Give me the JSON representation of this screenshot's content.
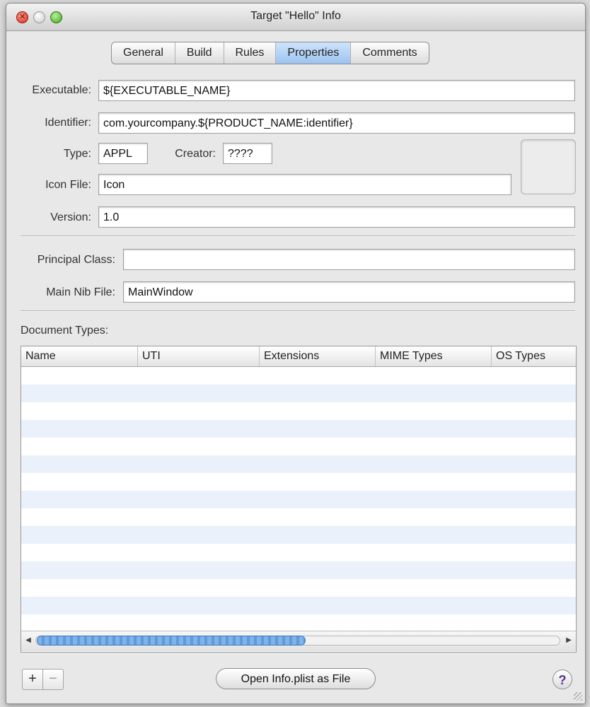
{
  "window": {
    "title": "Target \"Hello\" Info"
  },
  "tabs": [
    {
      "label": "General"
    },
    {
      "label": "Build"
    },
    {
      "label": "Rules"
    },
    {
      "label": "Properties",
      "selected": true
    },
    {
      "label": "Comments"
    }
  ],
  "properties": {
    "executable": {
      "label": "Executable:",
      "value": "${EXECUTABLE_NAME}"
    },
    "identifier": {
      "label": "Identifier:",
      "value": "com.yourcompany.${PRODUCT_NAME:identifier}"
    },
    "type": {
      "label": "Type:",
      "value": "APPL"
    },
    "creator": {
      "label": "Creator:",
      "value": "????"
    },
    "icon_file": {
      "label": "Icon File:",
      "value": "Icon"
    },
    "version": {
      "label": "Version:",
      "value": "1.0"
    },
    "principal_class": {
      "label": "Principal Class:",
      "value": ""
    },
    "main_nib_file": {
      "label": "Main Nib File:",
      "value": "MainWindow"
    }
  },
  "document_types": {
    "label": "Document Types:",
    "columns": [
      "Name",
      "UTI",
      "Extensions",
      "MIME Types",
      "OS Types"
    ],
    "rows": []
  },
  "footer": {
    "add_label": "+",
    "remove_label": "−",
    "open_plist_label": "Open Info.plist as File",
    "help_label": "?"
  }
}
